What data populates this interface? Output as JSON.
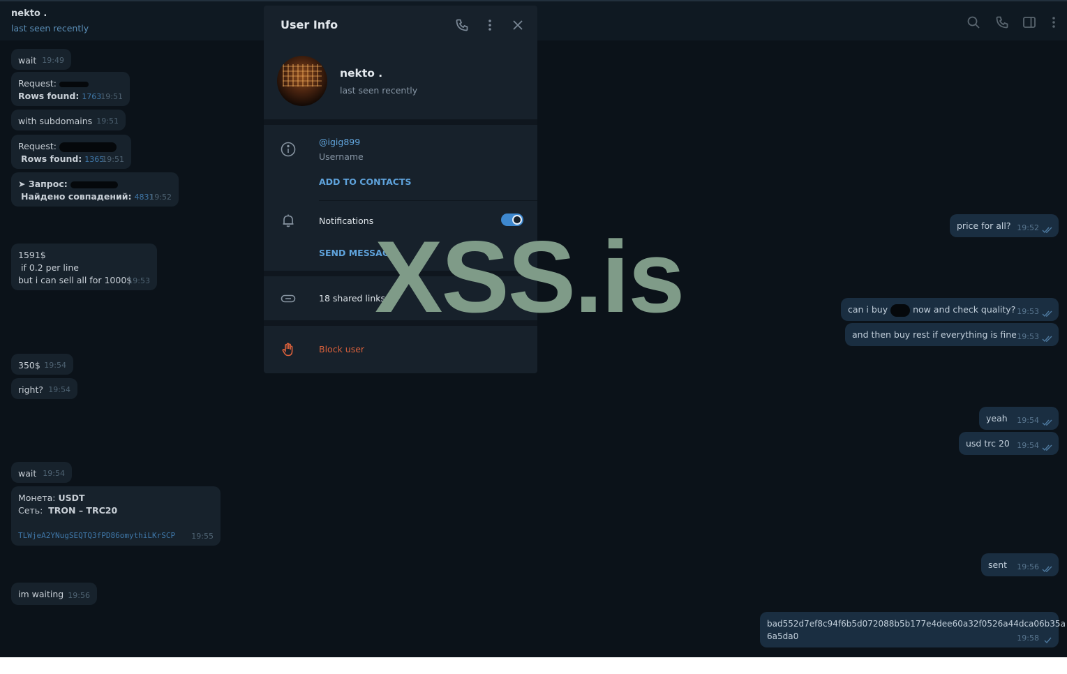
{
  "header": {
    "name": "nekto .",
    "status": "last seen recently"
  },
  "header_icons": [
    "search-icon",
    "phone-icon",
    "sidebar-icon",
    "more-vertical-icon"
  ],
  "messages_in": [
    {
      "text": "wait",
      "time": "19:49"
    },
    {
      "label1": "Request:",
      "label2": "Rows found:",
      "count": "1763",
      "time": "19:51"
    },
    {
      "text": "with subdomains",
      "time": "19:51"
    },
    {
      "label1": "Request:",
      "label2": "Rows found:",
      "count": "1365",
      "time": "19:51"
    },
    {
      "label1": "➤ Запрос:",
      "label2": "Найдено совпадений:",
      "count": "4831",
      "time": "19:52"
    },
    {
      "line1": "1591$",
      "line2": " if 0.2 per line",
      "line3": "but i can sell all for 1000$",
      "time": "19:53"
    },
    {
      "text": "350$",
      "time": "19:54"
    },
    {
      "text": "right?",
      "time": "19:54"
    },
    {
      "text": "wait",
      "time": "19:54"
    },
    {
      "coin_label": "Монета:",
      "coin": "USDT",
      "net_label": "Сеть:",
      "net": "TRON – TRC20",
      "address": "TLWjeA2YNugSEQTQ3fPD86omythiLKrSCP",
      "time": "19:55"
    },
    {
      "text": "im waiting",
      "time": "19:56"
    }
  ],
  "messages_out": [
    {
      "text": "price for all?",
      "time": "19:52"
    },
    {
      "text_a": "can i buy",
      "text_b": "now and check quality?",
      "time": "19:53"
    },
    {
      "text": "and then buy rest if everything is fine",
      "time": "19:53"
    },
    {
      "text": "yeah",
      "time": "19:54"
    },
    {
      "text": "usd trc 20",
      "time": "19:54"
    },
    {
      "text": "sent",
      "time": "19:56"
    },
    {
      "line1": "bad552d7ef8c94f6b5d072088b5b177e4dee60a32f0526a44dca06b35a",
      "line2": "6a5da0",
      "time": "19:58"
    }
  ],
  "user_info": {
    "title": "User Info",
    "name": "nekto .",
    "status": "last seen recently",
    "username": "@igig899",
    "username_label": "Username",
    "add_contacts": "ADD TO CONTACTS",
    "notifications": "Notifications",
    "notifications_on": true,
    "send_message": "SEND MESSAGE",
    "shared_links": "18 shared links",
    "block_user": "Block user"
  },
  "watermark": "XSS.is",
  "colors": {
    "accent": "#3e88cf",
    "danger": "#d9603b",
    "watermark": "#7f9b88"
  }
}
